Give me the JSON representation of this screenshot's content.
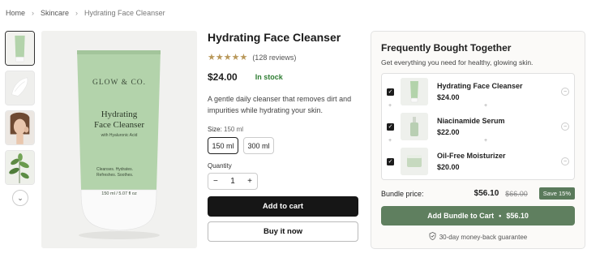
{
  "breadcrumb": {
    "items": [
      "Home",
      "Skincare",
      "Hydrating Face Cleanser"
    ]
  },
  "gallery": {
    "thumbnails": [
      "cleanser-tube",
      "cream-swatch",
      "woman-face",
      "green-leaves"
    ],
    "more_icon": "chevron-down-icon",
    "main_image": {
      "brand": "GLOW & CO.",
      "product_line1": "Hydrating",
      "product_line2": "Face Cleanser",
      "ingredient": "with Hyaluronic Acid",
      "benefit1": "Cleanses. Hydrates.",
      "benefit2": "Refreshes. Soothes.",
      "volume": "150 ml / 5.07 fl oz"
    }
  },
  "product": {
    "title": "Hydrating Face Cleanser",
    "stars": "★★★★★",
    "reviews": "(128 reviews)",
    "price": "$24.00",
    "stock": "In stock",
    "description": "A gentle daily cleanser that removes dirt and impurities while hydrating your skin.",
    "size_label": "Size:",
    "size_selected": "150 ml",
    "sizes": [
      "150 ml",
      "300 ml"
    ],
    "quantity_label": "Quantity",
    "quantity_minus": "−",
    "quantity": "1",
    "quantity_plus": "+",
    "add_to_cart": "Add to cart",
    "buy_now": "Buy it now"
  },
  "bundle": {
    "title": "Frequently Bought Together",
    "subtitle": "Get everything you need for healthy, glowing skin.",
    "items": [
      {
        "name": "Hydrating Face Cleanser",
        "price": "$24.00"
      },
      {
        "name": "Niacinamide Serum",
        "price": "$22.00"
      },
      {
        "name": "Oil-Free Moisturizer",
        "price": "$20.00"
      }
    ],
    "price_label": "Bundle price:",
    "price_new": "$56.10",
    "price_old": "$66.00",
    "save": "Save 15%",
    "button": "Add Bundle to Cart",
    "button_sep": "•",
    "button_price": "$56.10",
    "guarantee": "30-day money-back guarantee"
  },
  "colors": {
    "accent_green": "#5f7f5f",
    "stock_green": "#2e7d32",
    "star_gold": "#b9985a",
    "tube_green": "#b3d3ab"
  }
}
